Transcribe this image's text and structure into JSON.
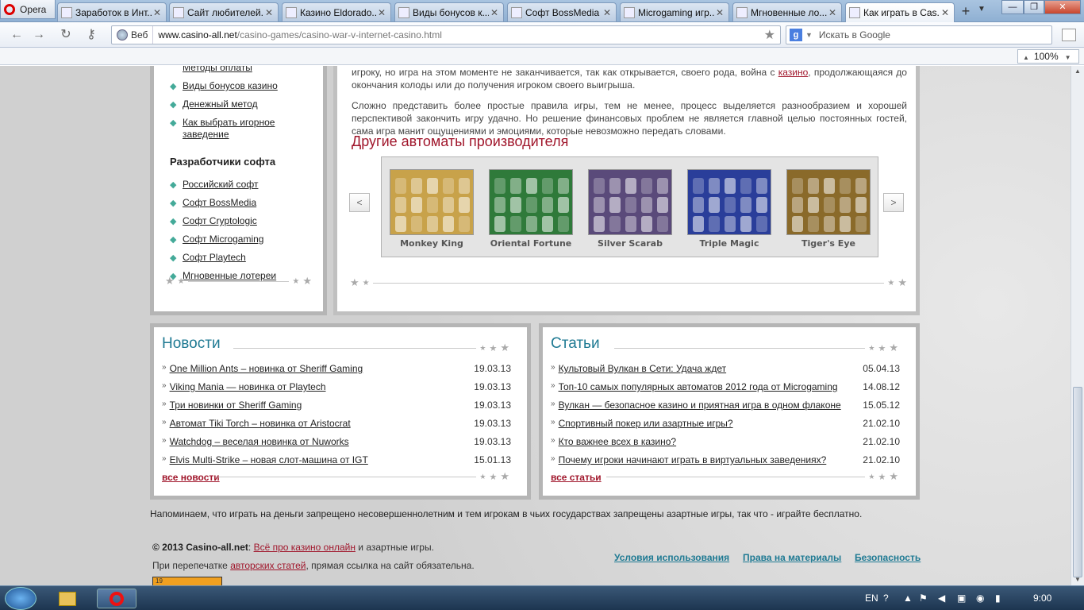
{
  "browser": {
    "menu_label": "Opera",
    "tabs": [
      {
        "label": "Заработок в Инт...",
        "active": false
      },
      {
        "label": "Сайт любителей...",
        "active": false
      },
      {
        "label": "Казино Eldorado...",
        "active": false
      },
      {
        "label": "Виды бонусов к...",
        "active": false
      },
      {
        "label": "Софт BossMedia",
        "active": false
      },
      {
        "label": "Microgaming игр...",
        "active": false
      },
      {
        "label": "Мгновенные ло...",
        "active": false
      },
      {
        "label": "Как играть в Cas...",
        "active": true
      }
    ],
    "new_tab": "+",
    "web_label": "Веб",
    "url_domain": "www.casino-all.net",
    "url_path": "/casino-games/casino-war-v-internet-casino.html",
    "search_placeholder": "Искать в Google",
    "zoom": "100%"
  },
  "sidebar": {
    "partial_item": "Методы оплаты",
    "items_top": [
      {
        "label": "Виды бонусов казино"
      },
      {
        "label": "Денежный метод"
      },
      {
        "label": "Как выбрать игорное заведение"
      }
    ],
    "dev_heading": "Разработчики софта",
    "items_dev": [
      {
        "label": "Российский софт"
      },
      {
        "label": "Софт BossMedia"
      },
      {
        "label": "Софт Cryptologic"
      },
      {
        "label": "Софт Microgaming"
      },
      {
        "label": "Софт Playtech"
      },
      {
        "label": "Мгновенные лотереи"
      }
    ]
  },
  "content": {
    "para1_start": "игроку, но игра на этом моменте не заканчивается, так как открывается, своего рода, война с",
    "para1_link": "казино",
    "para1_end": ", продолжающаяся до окончания колоды или до получения игроком своего выигрыша.",
    "para2": "Сложно представить более простые правила игры, тем не менее, процесс выделяется разнообразием и хорошей перспективой закончить игру удачно. Но решение финансовых проблем не является главной целью постоянных гостей, сама игра манит ощущениями и эмоциями, которые невозможно передать словами.",
    "other_heading": "Другие автоматы производителя",
    "prev": "<",
    "next": ">",
    "slots": [
      {
        "name": "Monkey King",
        "color": "#c8a24a"
      },
      {
        "name": "Oriental Fortune",
        "color": "#2f7a3a"
      },
      {
        "name": "Silver Scarab",
        "color": "#5a4a7a"
      },
      {
        "name": "Triple Magic",
        "color": "#2a3e9a"
      },
      {
        "name": "Tiger's Eye",
        "color": "#8a6a2a"
      }
    ]
  },
  "news": {
    "title": "Новости",
    "items": [
      {
        "title": "One Million Ants – новинка от Sheriff Gaming",
        "date": "19.03.13"
      },
      {
        "title": "Viking Mania — новинка от Playtech",
        "date": "19.03.13"
      },
      {
        "title": "Три новинки от Sheriff Gaming",
        "date": "19.03.13"
      },
      {
        "title": "Автомат Tiki Torch – новинка от Aristocrat",
        "date": "19.03.13"
      },
      {
        "title": "Watchdog – веселая новинка от Nuworks",
        "date": "19.03.13"
      },
      {
        "title": "Elvis Multi-Strike – новая слот-машина от IGT",
        "date": "15.01.13"
      }
    ],
    "all_label": "все новости"
  },
  "articles": {
    "title": "Статьи",
    "items": [
      {
        "title": "Культовый Вулкан в Сети: Удача ждет",
        "date": "05.04.13"
      },
      {
        "title": "Топ-10 самых популярных автоматов 2012 года от Microgaming",
        "date": "14.08.12"
      },
      {
        "title": "Вулкан — безопасное казино и приятная игра в одном флаконе",
        "date": "15.05.12"
      },
      {
        "title": "Спортивный покер или азартные игры?",
        "date": "21.02.10"
      },
      {
        "title": "Кто важнее всех в казино?",
        "date": "21.02.10"
      },
      {
        "title": "Почему игроки начинают играть в виртуальных заведениях?",
        "date": "21.02.10"
      }
    ],
    "all_label": "все статьи"
  },
  "footer": {
    "disclaimer": "Напоминаем, что играть на деньги запрещено несовершеннолетним и тем игрокам в чьих государствах запрещены азартные игры, так что - играйте бесплатно.",
    "copyright_prefix": "© 2013 Casino-all.net",
    "copyright_sep": ": ",
    "copyright_link": "Всё про казино онлайн",
    "copyright_suffix": " и азартные игры.",
    "reprint_prefix": "При перепечатке ",
    "reprint_link": "авторских статей",
    "reprint_suffix": ", прямая ссылка на сайт обязательна.",
    "links": [
      "Условия использования",
      "Права на материалы",
      "Безопасность"
    ],
    "counter": "19"
  },
  "taskbar": {
    "lang": "EN",
    "time": "9:00"
  }
}
